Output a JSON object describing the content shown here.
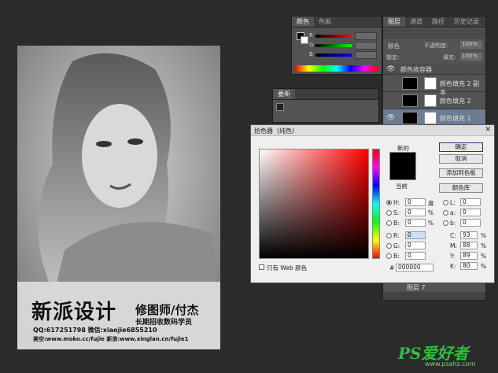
{
  "color_panel": {
    "tab1": "颜色",
    "tab2": "色板",
    "r_label": "R",
    "g_label": "G",
    "b_label": "B"
  },
  "adjust_panel": {
    "tab": "要新"
  },
  "layers_panel": {
    "tabs": [
      "图层",
      "通道",
      "路径",
      "历史记录"
    ],
    "mode_label": "颜色",
    "opacity_label": "不透明度:",
    "opacity_value": "100%",
    "lock_label": "锁定:",
    "fill_label": "填充:",
    "fill_value": "100%",
    "group_name": "颜色收容器",
    "layers": [
      "颜色填充 2 副本",
      "颜色填充 2",
      "颜色填充 1"
    ],
    "bottom_layer": "图层 7"
  },
  "document": {
    "title_big": "新派设计",
    "title_small": "修图师/付杰",
    "sub": "长期招收数码学员",
    "line1": "QQ:617251798  微信:xiaojie6855210",
    "line2": "美空:www.moko.cc/fujie  新浪:www.xinglan.cn/fujie1"
  },
  "picker": {
    "title": "拾色器（纯色）",
    "new_label": "新的",
    "current_label": "当前",
    "ok": "确定",
    "cancel": "取消",
    "add_swatch": "添加到色板",
    "color_lib": "颜色库",
    "h_label": "H:",
    "h_value": "0",
    "h_unit": "度",
    "s_label": "S:",
    "s_value": "0",
    "s_unit": "%",
    "b_label": "B:",
    "b_value": "0",
    "b_unit": "%",
    "r_label": "R:",
    "r_value": "0",
    "g_label": "G:",
    "g_value": "0",
    "bl_label": "B:",
    "bl_value": "0",
    "l_label": "L:",
    "l_value": "0",
    "a_label": "a:",
    "a_value": "0",
    "lb_label": "b:",
    "lb_value": "0",
    "c_label": "C:",
    "c_value": "93",
    "m_label": "M:",
    "m_value": "88",
    "y_label": "Y:",
    "y_value": "89",
    "k_label": "K:",
    "k_value": "80",
    "pct": "%",
    "web_only": "只有 Web 颜色",
    "hex_label": "#",
    "hex_value": "000000",
    "new_color": "#000000",
    "current_color": "#000000"
  },
  "watermark": {
    "brand": "PS爱好者",
    "url": "www.psahz.com"
  }
}
